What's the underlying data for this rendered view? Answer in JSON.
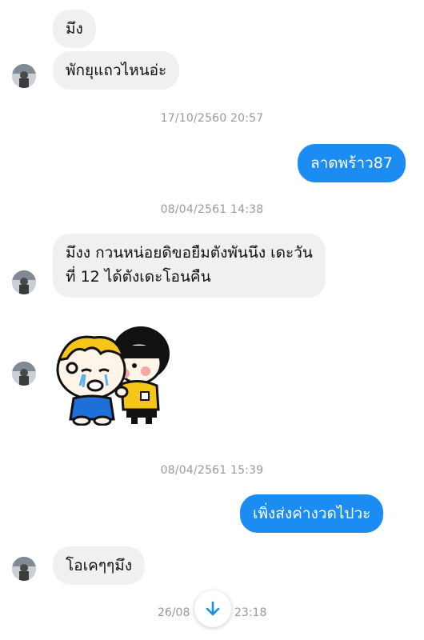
{
  "colors": {
    "accent": "#1b8cf2",
    "incoming_bubble": "#f0f0f0",
    "timestamp_text": "#9a9a9a"
  },
  "messages": [
    {
      "direction": "incoming",
      "text": "มึง"
    },
    {
      "direction": "incoming",
      "text": "พักยุแถวไหนอ่ะ"
    },
    {
      "type": "timestamp",
      "text": "17/10/2560 20:57"
    },
    {
      "direction": "outgoing",
      "text": "ลาดพร้าว87"
    },
    {
      "type": "timestamp",
      "text": "08/04/2561 14:38"
    },
    {
      "direction": "incoming",
      "lines": [
        "มึงง กวนหน่อยดิขอยืมตังพันนึง เดะวัน",
        "ที่ 12 ได้ตังเดะโอนคืน"
      ]
    },
    {
      "direction": "incoming",
      "type": "sticker",
      "icon": "crying-kids-sticker"
    },
    {
      "type": "timestamp",
      "text": "08/04/2561 15:39"
    },
    {
      "direction": "outgoing",
      "text": "เพิ่งส่งค่างวดไปวะ"
    },
    {
      "direction": "incoming",
      "text": "โอเคๆๆมึง"
    },
    {
      "type": "timestamp",
      "text": "26/08",
      "suffix": "23:18"
    }
  ],
  "scroll_button": {
    "icon": "arrow-down-icon"
  }
}
